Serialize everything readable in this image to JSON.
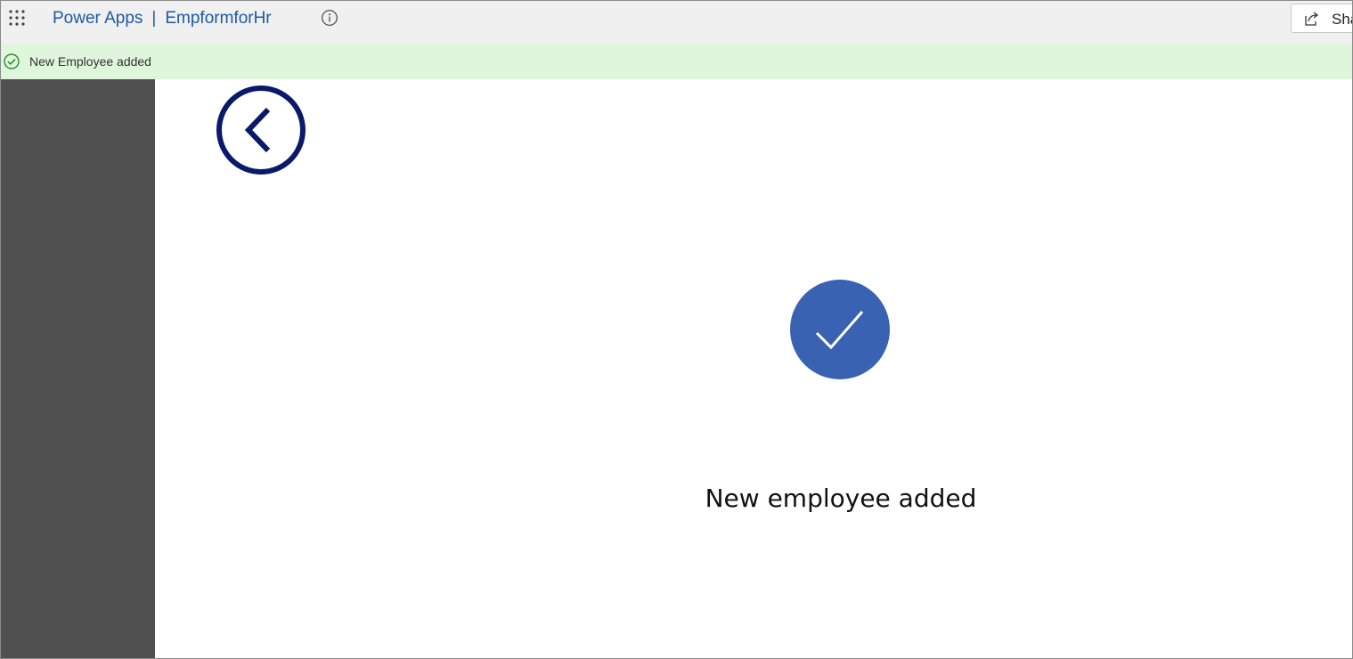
{
  "header": {
    "app_name": "Power Apps",
    "separator": "|",
    "app_title": "EmpformforHr",
    "share_label": "Share",
    "icons": {
      "launcher": "waffle-icon",
      "info": "info-icon",
      "share": "share-icon"
    }
  },
  "notification": {
    "message": "New Employee added",
    "icon": "success-check-icon",
    "color": "#dff6dd"
  },
  "screen": {
    "back_icon": "back-arrow-circle-icon",
    "success_icon": "checkmark-circle-icon",
    "success_message": "New employee added"
  },
  "colors": {
    "brand_text": "#1e5aa0",
    "left_panel": "#505050",
    "back_button": "#0a1a6b",
    "success_circle": "#3a62b3"
  }
}
